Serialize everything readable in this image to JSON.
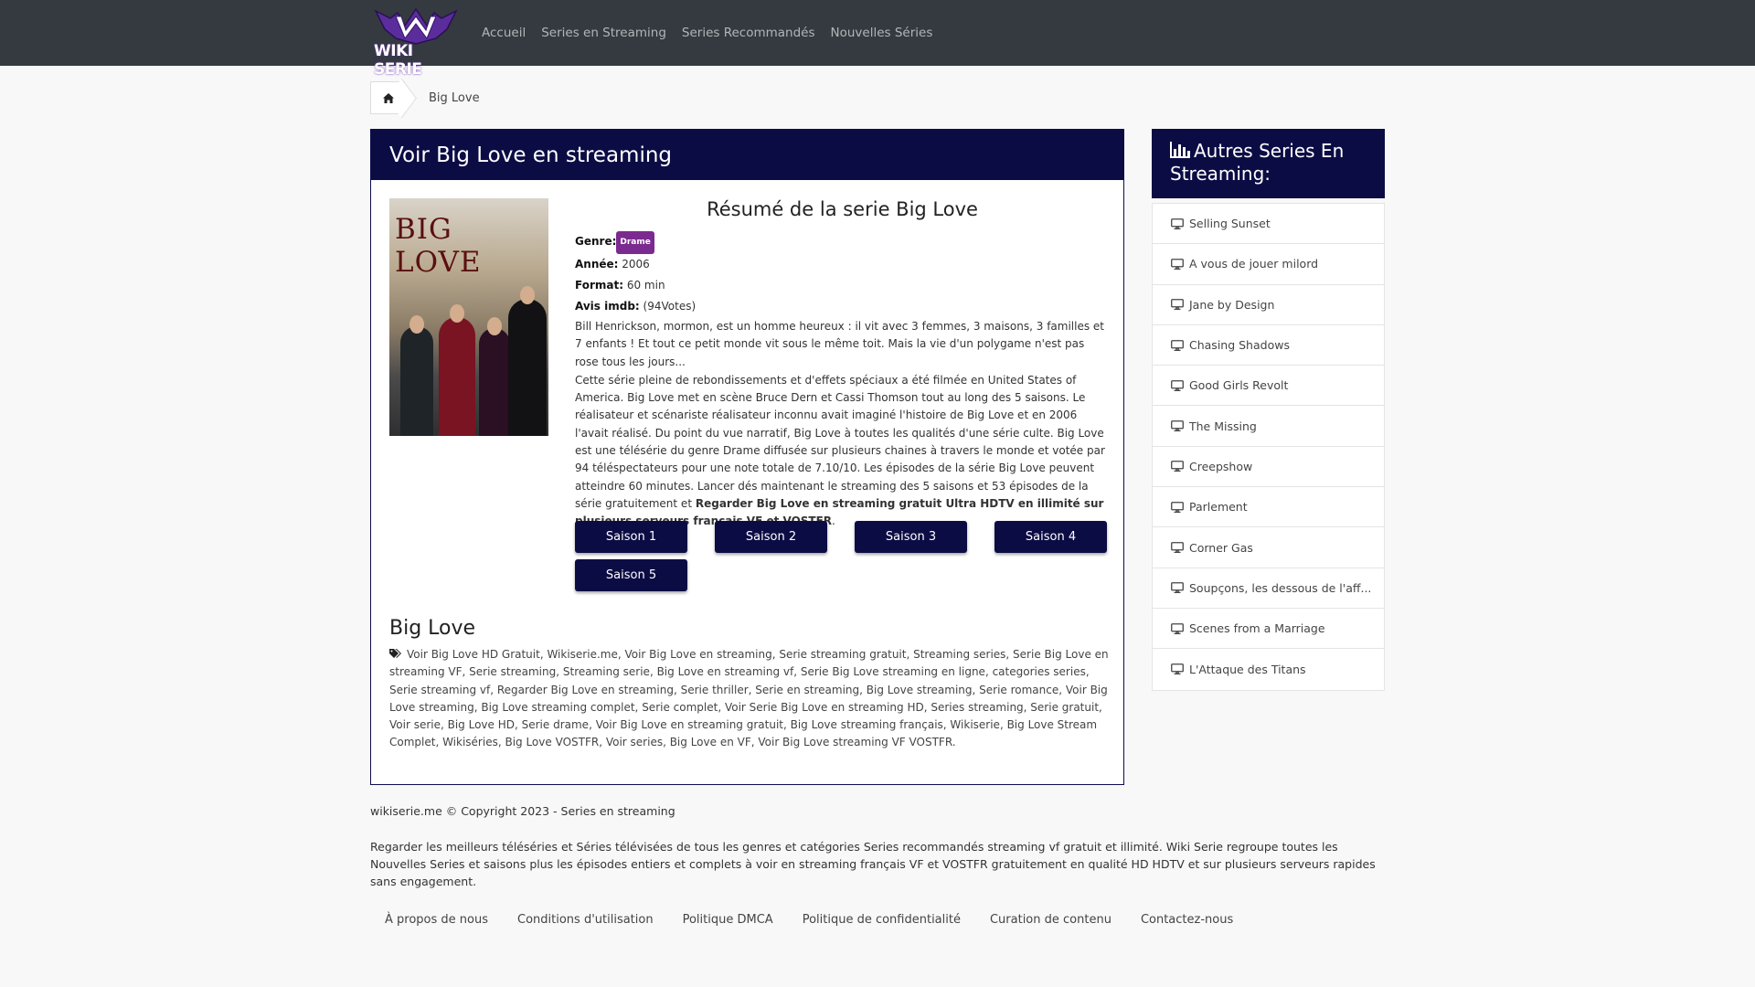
{
  "nav": {
    "logo_text": "WIKI SERIE",
    "links": [
      "Accueil",
      "Series en Streaming",
      "Series Recommandés",
      "Nouvelles Séries"
    ]
  },
  "breadcrumb": {
    "current": "Big Love"
  },
  "card": {
    "header": "Voir Big Love en streaming",
    "poster_title": "BIG LOVE",
    "summary_title": "Résumé de la serie Big Love",
    "genre_label": "Genre:",
    "genre": "Drame",
    "year_label": "Année:",
    "year": "2006",
    "format_label": "Format:",
    "format": "60 min",
    "imdb_label": "Avis imdb:",
    "imdb": "(94Votes)",
    "desc_plain": "Bill Henrickson, mormon, est un homme heureux : il vit avec 3 femmes, 3 maisons, 3 familles et 7 enfants ! Et tout ce petit monde vit sous le même toit. Mais la vie d'un polygame n'est pas rose tous les jours...",
    "desc_long": "Cette série pleine de rebondissements et d'effets spéciaux a été filmée en United States of America. Big Love met en scène Bruce Dern et Cassi Thomson tout au long des 5 saisons. Le réalisateur et scénariste réalisateur inconnu avait imaginé l'histoire de Big Love et en 2006 l'avait réalisé. Du point du vue narratif, Big Love à toutes les qualités d'une série culte. Big Love est une télésérie du genre Drame diffusée sur plusieurs chaines à travers le monde et votée par 94 téléspectateurs pour une note totale de 7.10/10. Les épisodes de la série Big Love peuvent atteindre 60 minutes. Lancer dés maintenant le streaming des 5 saisons et 53 épisodes de la série gratuitement et ",
    "desc_bold": "Regarder Big Love en streaming gratuit Ultra HDTV en illimité sur plusieurs serveurs français VF et VOSTFR",
    "desc_end": ".",
    "seasons": [
      "Saison 1",
      "Saison 2",
      "Saison 3",
      "Saison 4",
      "Saison 5"
    ],
    "tags_title": "Big Love",
    "tags": "Voir Big Love HD Gratuit, Wikiserie.me, Voir Big Love en streaming, Serie streaming gratuit, Streaming series, Serie Big Love en streaming VF, Serie streaming, Streaming serie, Big Love en streaming vf, Serie Big Love streaming en ligne, categories series, Serie streaming vf, Regarder Big Love en streaming, Serie thriller, Serie en streaming, Big Love streaming, Serie romance, Voir Big Love streaming, Big Love streaming complet, Serie complet, Voir Serie Big Love en streaming HD, Series streaming, Serie gratuit, Voir serie, Big Love HD, Serie drame, Voir Big Love en streaming gratuit, Big Love streaming français, Wikiserie, Big Love Stream Complet, Wikiséries, Big Love VOSTFR, Voir series, Big Love en VF, Voir Big Love streaming VF VOSTFR."
  },
  "sidebar": {
    "title": "Autres Series En Streaming:",
    "items": [
      "Selling Sunset",
      "A vous de jouer milord",
      "Jane by Design",
      "Chasing Shadows",
      "Good Girls Revolt",
      "The Missing",
      "Creepshow",
      "Parlement",
      "Corner Gas",
      "Soupçons, les dessous de l'aff...",
      "Scenes from a Marriage",
      "L'Attaque des Titans"
    ]
  },
  "footer": {
    "copyright": "wikiserie.me © Copyright 2023 - Series en streaming",
    "about": "Regarder les meilleurs téléséries et Séries télévisées de tous les genres et catégories Series recommandés streaming vf gratuit et illimité. Wiki Serie regroupe toutes les Nouvelles Series et saisons plus les épisodes entiers et complets à voir en streaming français VF et VOSTFR gratuitement en qualité HD HDTV et sur plusieurs serveurs rapides sans engagement.",
    "links": [
      "À propos de nous",
      "Conditions d'utilisation",
      "Politique DMCA",
      "Politique de confidentialité",
      "Curation de contenu",
      "Contactez-nous"
    ]
  },
  "icons": {
    "home": "home-icon",
    "chart": "bar-chart-icon",
    "monitor": "monitor-icon",
    "tags": "tags-icon"
  },
  "colors": {
    "navbar": "#343a40",
    "accent": "#0c0c45",
    "badge": "#7b2b8f",
    "background": "#f8f8f8"
  }
}
